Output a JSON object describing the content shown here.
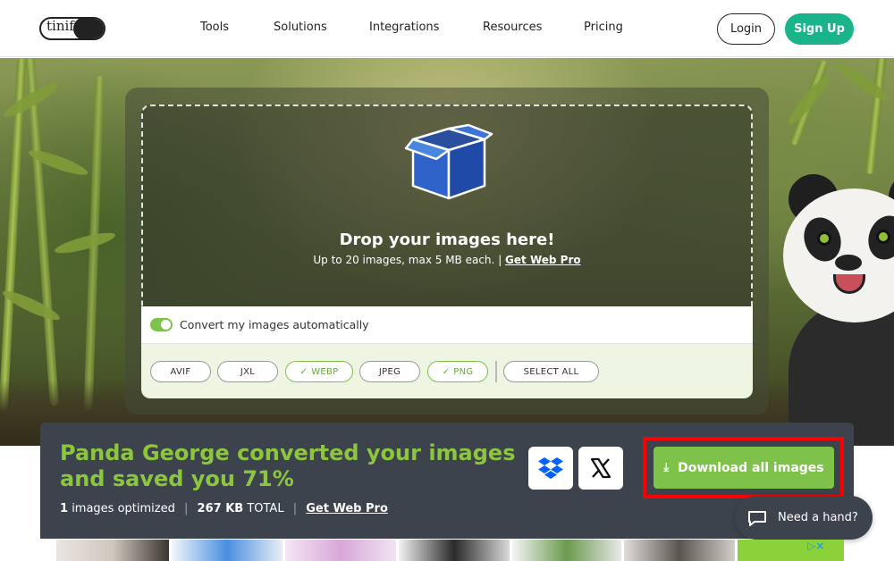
{
  "header": {
    "logo_text": "tinify",
    "nav": [
      "Tools",
      "Solutions",
      "Integrations",
      "Resources",
      "Pricing"
    ],
    "login_label": "Login",
    "signup_label": "Sign Up"
  },
  "upload": {
    "title": "Drop your images here!",
    "subtitle": "Up to 20 images, max 5 MB each.",
    "subtitle_link": "Get Web Pro",
    "auto_convert_label": "Convert my images automatically",
    "auto_convert_on": true,
    "formats": [
      {
        "label": "AVIF",
        "selected": false
      },
      {
        "label": "JXL",
        "selected": false
      },
      {
        "label": "WEBP",
        "selected": true
      },
      {
        "label": "JPEG",
        "selected": false
      },
      {
        "label": "PNG",
        "selected": true
      }
    ],
    "select_all_label": "SELECT ALL"
  },
  "result": {
    "title": "Panda George converted your images and saved you 71%",
    "count": "1",
    "count_label": "images optimized",
    "size": "267 KB",
    "size_label": "TOTAL",
    "pro_link": "Get Web Pro",
    "download_label": "Download all images",
    "share_icons": [
      "dropbox-icon",
      "x-icon"
    ]
  },
  "help": {
    "label": "Need a hand?"
  },
  "ad": {
    "marker": "▷×"
  },
  "colors": {
    "brand_green": "#19b489",
    "accent_green": "#7ec24a",
    "title_green": "#8cc63f",
    "panel_dark": "#3d434d",
    "highlight_red": "#ff0000"
  }
}
